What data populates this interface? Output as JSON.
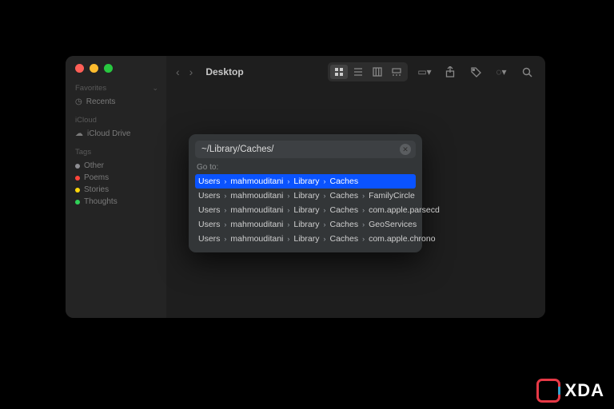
{
  "window": {
    "title": "Desktop"
  },
  "sidebar": {
    "favorites_label": "Favorites",
    "favorites": [
      {
        "label": "Recents"
      }
    ],
    "icloud_label": "iCloud",
    "icloud": [
      {
        "label": "iCloud Drive"
      }
    ],
    "tags_label": "Tags",
    "tags": [
      {
        "label": "Other",
        "color": "#8e8e93"
      },
      {
        "label": "Poems",
        "color": "#ff453a"
      },
      {
        "label": "Stories",
        "color": "#ffd60a"
      },
      {
        "label": "Thoughts",
        "color": "#30d158"
      }
    ]
  },
  "goto": {
    "input_value": "~/Library/Caches/",
    "label": "Go to:",
    "clear_glyph": "✕",
    "suggestions": [
      {
        "crumbs": [
          "Users",
          "mahmouditani",
          "Library",
          "Caches"
        ],
        "selected": true
      },
      {
        "crumbs": [
          "Users",
          "mahmouditani",
          "Library",
          "Caches",
          "FamilyCircle"
        ]
      },
      {
        "crumbs": [
          "Users",
          "mahmouditani",
          "Library",
          "Caches",
          "com.apple.parsecd"
        ]
      },
      {
        "crumbs": [
          "Users",
          "mahmouditani",
          "Library",
          "Caches",
          "GeoServices"
        ]
      },
      {
        "crumbs": [
          "Users",
          "mahmouditani",
          "Library",
          "Caches",
          "com.apple.chrono"
        ]
      }
    ]
  },
  "watermark": {
    "text": "XDA"
  }
}
